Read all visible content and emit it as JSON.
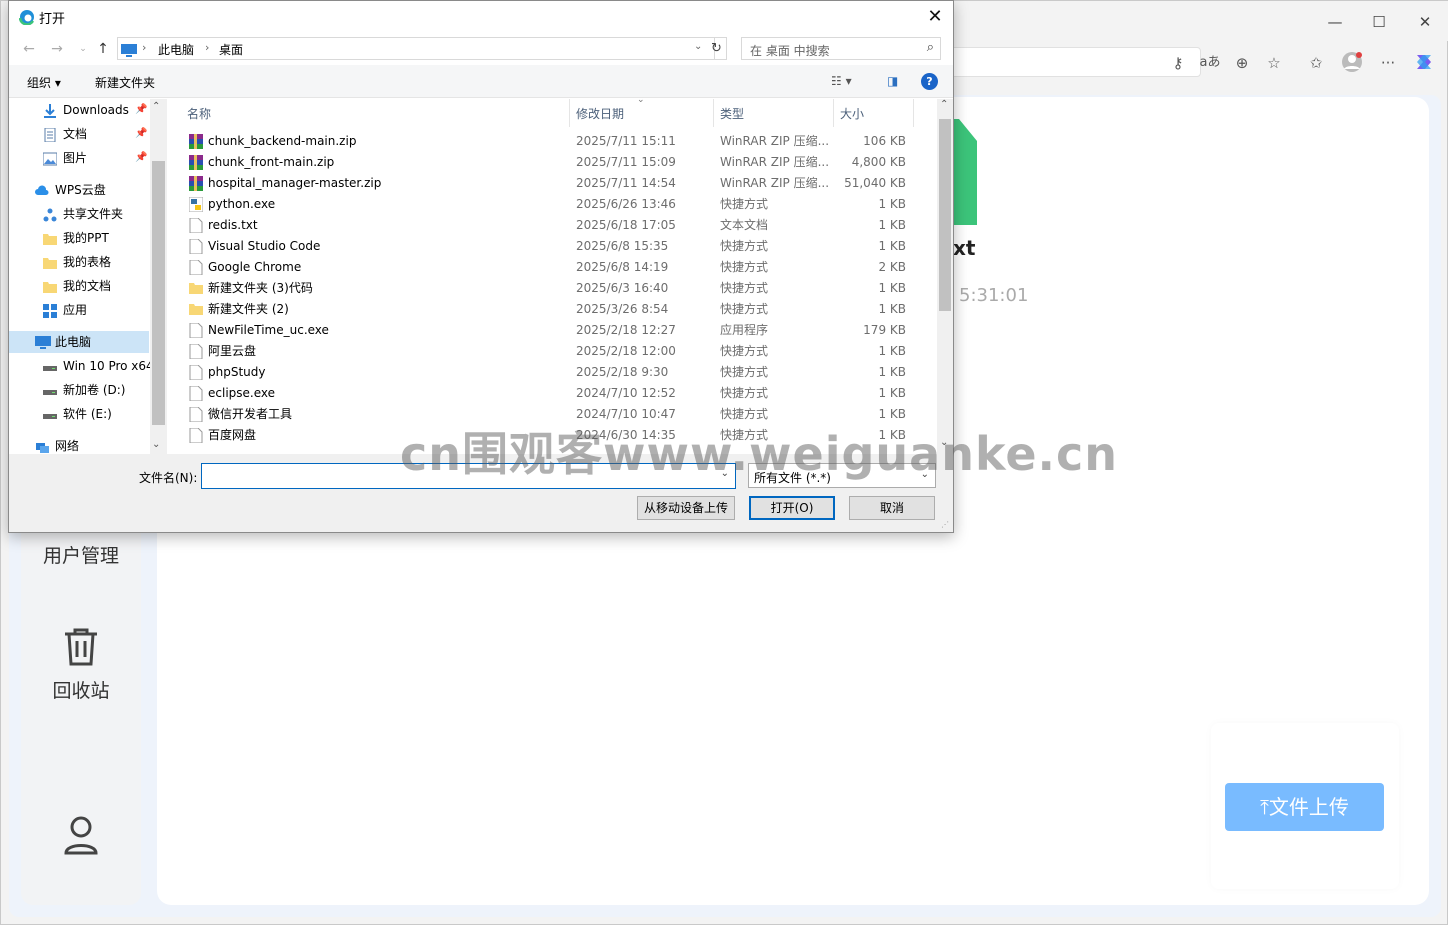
{
  "browser": {
    "content_title_frag": "xt",
    "content_time_frag": "5:31:01",
    "sidebar": {
      "user_mgmt": "用户管理",
      "recycle": "回收站"
    },
    "upload_button": "⤒文件上传"
  },
  "dialog": {
    "title": "打开",
    "path": [
      "此电脑",
      "桌面"
    ],
    "search_placeholder": "在 桌面 中搜索",
    "commands": {
      "organize": "组织 ▾",
      "new_folder": "新建文件夹"
    },
    "nav_items": [
      {
        "label": "Downloads",
        "icon": "download-arrow-icon",
        "pinned": true
      },
      {
        "label": "文档",
        "icon": "document-icon",
        "pinned": true
      },
      {
        "label": "图片",
        "icon": "picture-icon",
        "pinned": true
      },
      {
        "label": "WPS云盘",
        "icon": "cloud-icon",
        "pinned": false
      },
      {
        "label": "共享文件夹",
        "icon": "share-icon",
        "pinned": false
      },
      {
        "label": "我的PPT",
        "icon": "folder-icon",
        "pinned": false
      },
      {
        "label": "我的表格",
        "icon": "folder-icon",
        "pinned": false
      },
      {
        "label": "我的文档",
        "icon": "folder-icon",
        "pinned": false
      },
      {
        "label": "应用",
        "icon": "apps-icon",
        "pinned": false
      },
      {
        "label": "此电脑",
        "icon": "computer-icon",
        "pinned": false
      },
      {
        "label": "Win 10 Pro x64",
        "icon": "drive-icon",
        "pinned": false
      },
      {
        "label": "新加卷 (D:)",
        "icon": "drive-icon",
        "pinned": false
      },
      {
        "label": "软件 (E:)",
        "icon": "drive-icon",
        "pinned": false
      },
      {
        "label": "网络",
        "icon": "network-icon",
        "pinned": false
      }
    ],
    "columns": {
      "name": "名称",
      "date": "修改日期",
      "type": "类型",
      "size": "大小"
    },
    "files": [
      {
        "name": "chunk_backend-main.zip",
        "date": "2025/7/11 15:11",
        "type": "WinRAR ZIP 压缩...",
        "size": "106 KB",
        "icon": "winrar-icon"
      },
      {
        "name": "chunk_front-main.zip",
        "date": "2025/7/11 15:09",
        "type": "WinRAR ZIP 压缩...",
        "size": "4,800 KB",
        "icon": "winrar-icon"
      },
      {
        "name": "hospital_manager-master.zip",
        "date": "2025/7/11 14:54",
        "type": "WinRAR ZIP 压缩...",
        "size": "51,040 KB",
        "icon": "winrar-icon"
      },
      {
        "name": "python.exe",
        "date": "2025/6/26 13:46",
        "type": "快捷方式",
        "size": "1 KB",
        "icon": "python-icon"
      },
      {
        "name": "redis.txt",
        "date": "2025/6/18 17:05",
        "type": "文本文档",
        "size": "1 KB",
        "icon": "file-icon"
      },
      {
        "name": "Visual Studio Code",
        "date": "2025/6/8 15:35",
        "type": "快捷方式",
        "size": "1 KB",
        "icon": "file-icon"
      },
      {
        "name": "Google Chrome",
        "date": "2025/6/8 14:19",
        "type": "快捷方式",
        "size": "2 KB",
        "icon": "file-icon"
      },
      {
        "name": "新建文件夹 (3)代码",
        "date": "2025/6/3 16:40",
        "type": "快捷方式",
        "size": "1 KB",
        "icon": "folder-icon"
      },
      {
        "name": "新建文件夹 (2)",
        "date": "2025/3/26 8:54",
        "type": "快捷方式",
        "size": "1 KB",
        "icon": "folder-icon"
      },
      {
        "name": "NewFileTime_uc.exe",
        "date": "2025/2/18 12:27",
        "type": "应用程序",
        "size": "179 KB",
        "icon": "file-icon"
      },
      {
        "name": "阿里云盘",
        "date": "2025/2/18 12:00",
        "type": "快捷方式",
        "size": "1 KB",
        "icon": "file-icon"
      },
      {
        "name": "phpStudy",
        "date": "2025/2/18 9:30",
        "type": "快捷方式",
        "size": "1 KB",
        "icon": "file-icon"
      },
      {
        "name": "eclipse.exe",
        "date": "2024/7/10 12:52",
        "type": "快捷方式",
        "size": "1 KB",
        "icon": "file-icon"
      },
      {
        "name": "微信开发者工具",
        "date": "2024/7/10 10:47",
        "type": "快捷方式",
        "size": "1 KB",
        "icon": "file-icon"
      },
      {
        "name": "百度网盘",
        "date": "2024/6/30 14:35",
        "type": "快捷方式",
        "size": "1 KB",
        "icon": "file-icon"
      }
    ],
    "filename_label": "文件名(N):",
    "filename_value": "",
    "filetype_value": "所有文件 (*.*)",
    "buttons": {
      "mobile_upload": "从移动设备上传",
      "open": "打开(O)",
      "cancel": "取消"
    }
  },
  "watermark": "cn围观客www.weiguanke.cn",
  "colors": {
    "accent": "#0067c0",
    "upload_button": "#79bbff",
    "selection": "#cce4f7"
  }
}
